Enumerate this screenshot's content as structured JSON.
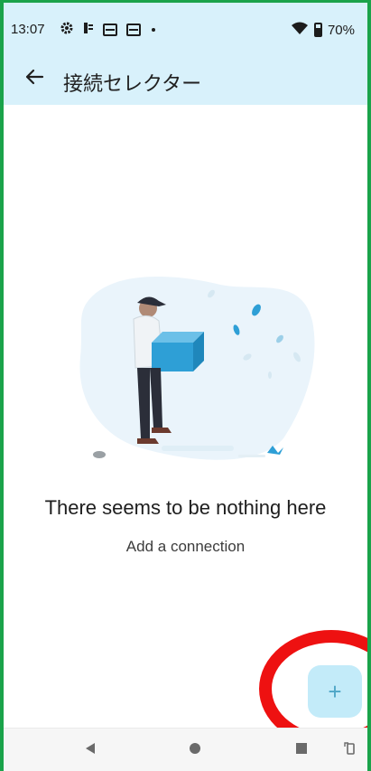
{
  "status_bar": {
    "time": "13:07",
    "battery": "70%",
    "icons": [
      "gear-icon",
      "notification-icon",
      "window-icon",
      "window-icon",
      "dot-icon",
      "wifi-icon",
      "battery-icon"
    ]
  },
  "app_bar": {
    "title": "接続セレクター",
    "back_icon": "arrow-left-icon"
  },
  "empty_state": {
    "title": "There seems to be nothing here",
    "subtitle": "Add a connection"
  },
  "fab": {
    "label": "+"
  },
  "nav_bar": {
    "icons": [
      "back-triangle-icon",
      "home-circle-icon",
      "recents-square-icon",
      "rotate-icon"
    ]
  },
  "colors": {
    "app_bar_bg": "#d8f1fb",
    "accent": "#4ea6c7",
    "fab_bg": "#c3ebf9",
    "annotation_red": "#ee1111",
    "frame_green": "#1aa34a"
  }
}
